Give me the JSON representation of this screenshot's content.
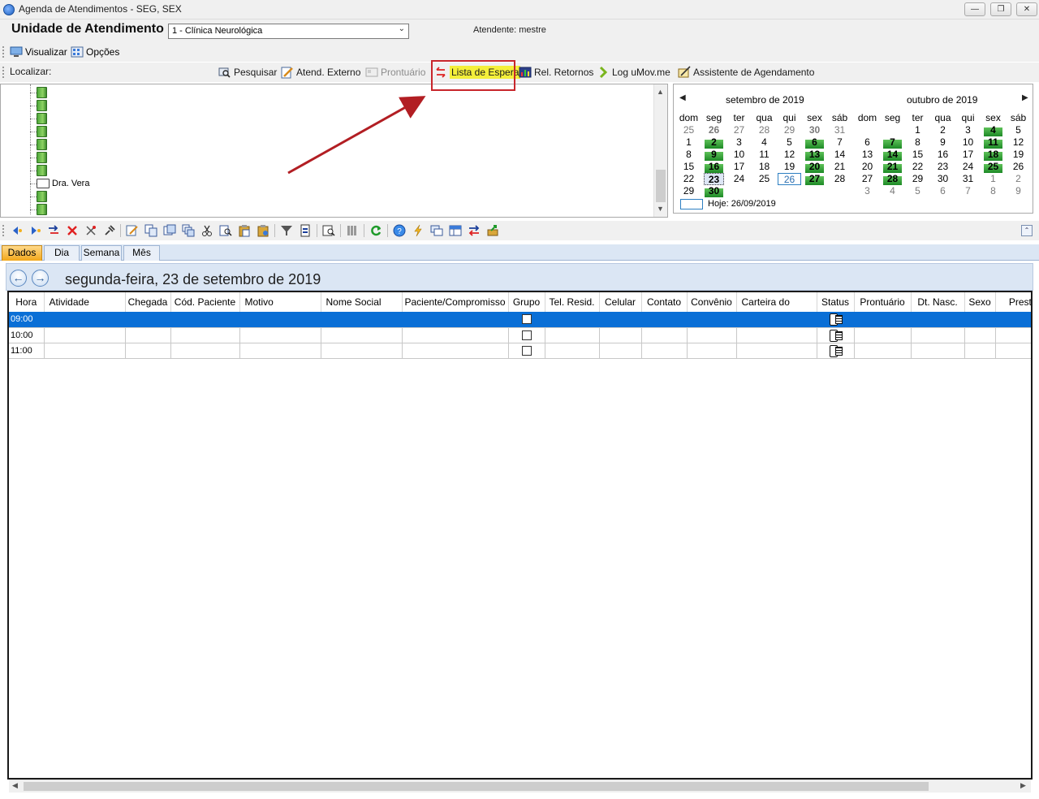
{
  "window": {
    "title": "Agenda de Atendimentos - SEG, SEX",
    "buttons": [
      "minimize",
      "restore",
      "close"
    ]
  },
  "header": {
    "unit_label": "Unidade de Atendimento",
    "unit_value": "1 - Clínica Neurológica",
    "attendant": "Atendente: mestre"
  },
  "menu": {
    "visualizar": "Visualizar",
    "opcoes": "Opções"
  },
  "search_toolbar": {
    "localizar": "Localizar:",
    "pesquisar": "Pesquisar",
    "atend_externo": "Atend. Externo",
    "prontuario": "Prontuário",
    "lista_espera": "Lista de Espera",
    "rel_retornos": "Rel. Retornos",
    "log_umovme": "Log uMov.me",
    "assistente": "Assistente de Agendamento"
  },
  "tree": {
    "doctor_label": "Dra. Vera"
  },
  "calendar": {
    "months": [
      "setembro de 2019",
      "outubro de 2019"
    ],
    "weekdays": [
      "dom",
      "seg",
      "ter",
      "qua",
      "qui",
      "sex",
      "sáb"
    ],
    "september": [
      [
        "25",
        "26",
        "27",
        "28",
        "29",
        "30",
        "31"
      ],
      [
        "1",
        "2",
        "3",
        "4",
        "5",
        "6",
        "7"
      ],
      [
        "8",
        "9",
        "10",
        "11",
        "12",
        "13",
        "14"
      ],
      [
        "15",
        "16",
        "17",
        "18",
        "19",
        "20",
        "21"
      ],
      [
        "22",
        "23",
        "24",
        "25",
        "26",
        "27",
        "28"
      ],
      [
        "29",
        "30",
        "",
        "",
        "",
        "",
        ""
      ]
    ],
    "october": [
      [
        "",
        "",
        "1",
        "2",
        "3",
        "4",
        "5"
      ],
      [
        "6",
        "7",
        "8",
        "9",
        "10",
        "11",
        "12"
      ],
      [
        "13",
        "14",
        "15",
        "16",
        "17",
        "18",
        "19"
      ],
      [
        "20",
        "21",
        "22",
        "23",
        "24",
        "25",
        "26"
      ],
      [
        "27",
        "28",
        "29",
        "30",
        "31",
        "1",
        "2"
      ],
      [
        "3",
        "4",
        "5",
        "6",
        "7",
        "8",
        "9"
      ]
    ],
    "today_label": "Hoje: 26/09/2019"
  },
  "tabs": [
    "Dados",
    "Dia",
    "Semana",
    "Mês"
  ],
  "day_header": {
    "date": "segunda-feira, 23 de setembro de 2019"
  },
  "grid": {
    "columns": [
      "Hora",
      "Atividade",
      "Chegada",
      "Cód. Paciente",
      "Motivo",
      "Nome Social",
      "Paciente/Compromisso",
      "Grupo",
      "Tel. Resid.",
      "Celular",
      "Contato",
      "Convênio",
      "Carteira do",
      "Status",
      "Prontuário",
      "Dt. Nasc.",
      "Sexo",
      "Prestad"
    ],
    "rows": [
      {
        "hora": "09:00"
      },
      {
        "hora": "10:00"
      },
      {
        "hora": "11:00"
      }
    ]
  },
  "colors": {
    "selection": "#0a6fd6",
    "annotation": "#c8262b",
    "highlight": "#f4ef3a",
    "calendar_busy": "#1d8a26"
  }
}
